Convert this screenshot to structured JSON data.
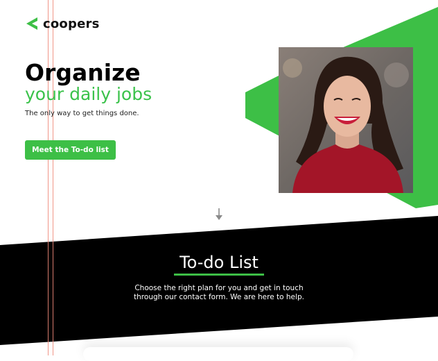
{
  "brand": {
    "name": "coopers",
    "accent_color": "#3dbf46",
    "logo_icon": "chevron-left-icon"
  },
  "hero": {
    "headline_line1": "Organize",
    "headline_line2": "your daily jobs",
    "tagline": "The only way to get things done.",
    "cta_label": "Meet the To-do list",
    "photo": "smiling-woman-portrait"
  },
  "scroll": {
    "icon": "arrow-down-icon"
  },
  "todo_section": {
    "title": "To-do List",
    "description_line1": "Choose the right plan for you and get in touch",
    "description_line2": "through our contact form. We are here to help."
  }
}
